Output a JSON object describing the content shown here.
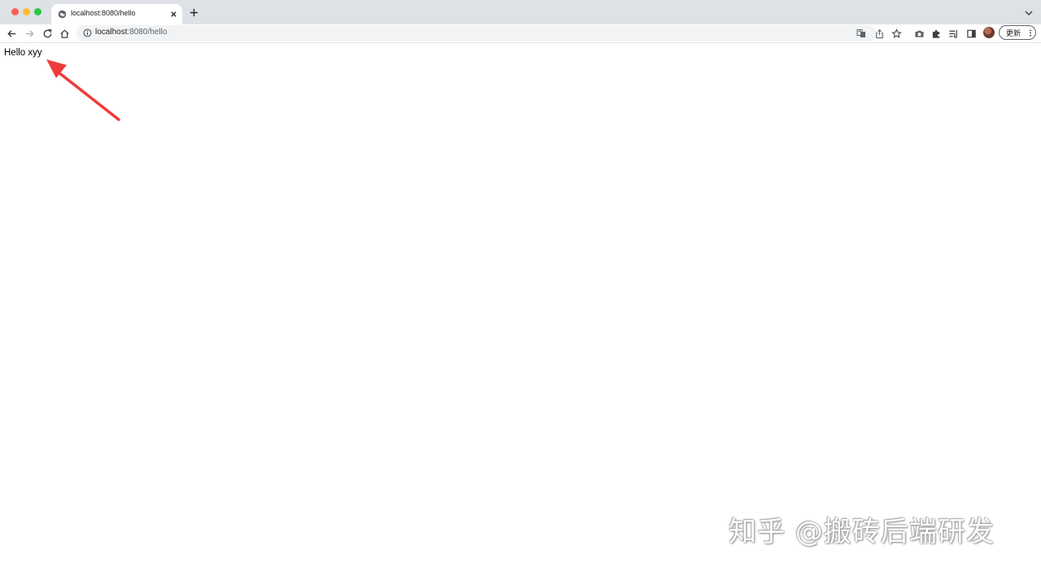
{
  "browser": {
    "tab": {
      "title": "localhost:8080/hello"
    },
    "address_bar": {
      "host": "localhost",
      "path": ":8080/hello"
    },
    "update_button": {
      "label": "更新"
    },
    "icons": [
      "back-arrow-icon",
      "forward-arrow-icon",
      "reload-icon",
      "home-icon",
      "info-icon",
      "translate-icon",
      "share-icon",
      "star-icon",
      "camera-icon",
      "extensions-icon",
      "reading-list-icon",
      "side-panel-icon",
      "more-vertical-icon"
    ]
  },
  "page": {
    "text": "Hello xyy"
  },
  "annotation": {
    "color": "#ef3b3b"
  },
  "watermark": {
    "text": "知乎 @搬砖后端研发"
  },
  "colors": {
    "tabstrip_bg": "#dee1e6",
    "omnibox_bg": "#f1f3f4",
    "close": "#fe5f57",
    "minimize": "#febc2e",
    "maximize": "#28c840"
  }
}
